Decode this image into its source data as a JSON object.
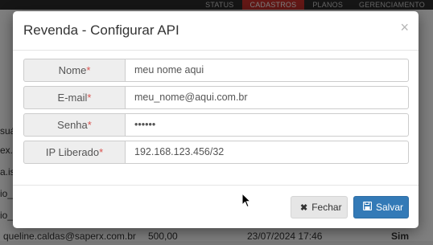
{
  "nav": {
    "items": [
      "STATUS",
      "CADASTROS",
      "PLANOS",
      "GERENCIAMENTO"
    ],
    "active_index": 1
  },
  "background": {
    "header_fragment": "suár",
    "row_fragments": [
      "ex.k",
      "a.is",
      "io_v",
      "io_v"
    ],
    "last_row": {
      "email": "queline.caldas@saperx.com.br",
      "value": "500,00",
      "datetime": "23/07/2024 17:46",
      "status": "Sim"
    }
  },
  "modal": {
    "title": "Revenda - Configurar API",
    "close_symbol": "×",
    "required_mark": "*",
    "fields": [
      {
        "label": "Nome",
        "value": "meu nome aqui",
        "type": "text"
      },
      {
        "label": "E-mail",
        "value": "meu_nome@aqui.com.br",
        "type": "text"
      },
      {
        "label": "Senha",
        "value": "123456",
        "type": "password"
      },
      {
        "label": "IP Liberado",
        "value": "192.168.123.456/32",
        "type": "text"
      }
    ],
    "buttons": {
      "cancel_label": "Fechar",
      "cancel_icon": "times-icon",
      "save_label": "Salvar",
      "save_icon": "floppy-disk-icon"
    }
  },
  "colors": {
    "nav_bg": "#2d2d2d",
    "nav_active": "#c9302c",
    "primary": "#337ab7",
    "required": "#d9534f"
  }
}
